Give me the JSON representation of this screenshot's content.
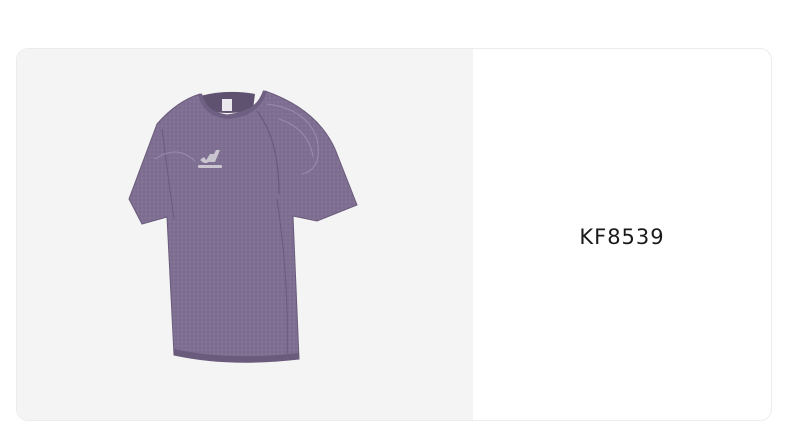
{
  "product": {
    "code": "KF8539",
    "image_icon": "purple-tshirt-icon",
    "colors": {
      "shirt": "#7f6f92",
      "shirt_shadow": "#6a5b7c",
      "shirt_highlight": "#8d7da0",
      "logo": "#c9c6cf",
      "image_background": "#f4f4f4"
    }
  }
}
